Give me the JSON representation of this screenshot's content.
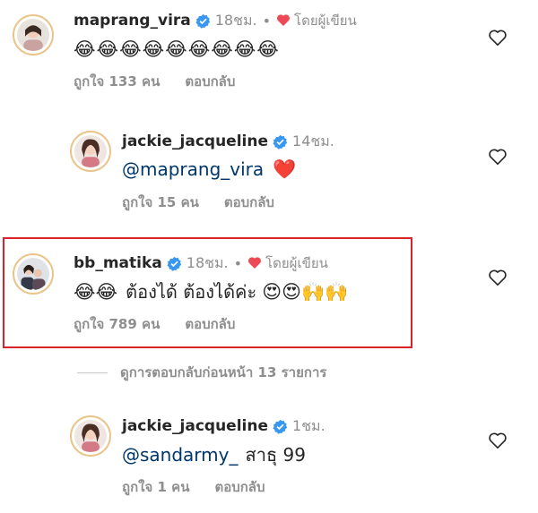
{
  "colors": {
    "accent_link": "#00376b",
    "muted": "#8e8e8e",
    "verified": "#3897f0",
    "author_heart": "#ed4956",
    "highlight_box": "#d8232a"
  },
  "comments": [
    {
      "username": "maprang_vira",
      "time": "18ชม.",
      "separator": "•",
      "author_like": "โดยผู้เขียน",
      "emoji_text": "😂😂😂😂😂😂😂😂😂",
      "likes": "ถูกใจ 133 คน",
      "reply": "ตอบกลับ"
    },
    {
      "username": "jackie_jacqueline",
      "time": "14ชม.",
      "mention": "@maprang_vira",
      "text": "",
      "emoji_text": "❤️",
      "likes": "ถูกใจ 15 คน",
      "reply": "ตอบกลับ"
    },
    {
      "username": "bb_matika",
      "time": "18ชม.",
      "separator": "•",
      "author_like": "โดยผู้เขียน",
      "emoji_pre": "😂😂",
      "text": "ต้องได้ ต้องได้ค่ะ",
      "emoji_post": "😍😍🙌🙌",
      "likes": "ถูกใจ 789 คน",
      "reply": "ตอบกลับ"
    },
    {
      "username": "jackie_jacqueline",
      "time": "1ชม.",
      "mention": "@sandarmy_",
      "text": "สาธุ 99",
      "likes": "ถูกใจ 1 คน",
      "reply": "ตอบกลับ"
    }
  ],
  "view_previous_replies": "ดูการตอบกลับก่อนหน้า 13 รายการ"
}
